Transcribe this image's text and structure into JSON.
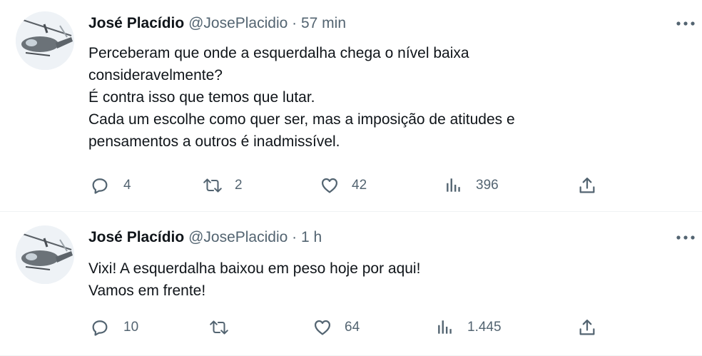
{
  "tweets": [
    {
      "author_name": "José Placídio",
      "handle": "@JosePlacidio",
      "separator": "·",
      "time": "57 min",
      "text_lines": [
        "Perceberam que onde a esquerdalha chega o nível baixa",
        "consideravelmente?",
        "É contra isso que temos que lutar.",
        "Cada um escolhe como quer ser, mas a imposição de atitudes e",
        "pensamentos a outros é inadmissível."
      ],
      "reply_count": "4",
      "retweet_count": "2",
      "like_count": "42",
      "view_count": "396"
    },
    {
      "author_name": "José Placídio",
      "handle": "@JosePlacidio",
      "separator": "·",
      "time": "1 h",
      "text_lines": [
        "Vixi! A esquerdalha baixou em peso hoje por aqui!",
        "Vamos em frente!"
      ],
      "reply_count": "10",
      "retweet_count": "",
      "like_count": "64",
      "view_count": "1.445"
    }
  ],
  "icons": {
    "avatar": "helicopter-avatar",
    "more": "more-options-icon",
    "reply": "reply-icon",
    "retweet": "retweet-icon",
    "like": "like-icon",
    "views": "views-icon",
    "share": "share-icon"
  },
  "colors": {
    "text_primary": "#0f1419",
    "text_secondary": "#536471",
    "divider": "#eff3f4"
  }
}
